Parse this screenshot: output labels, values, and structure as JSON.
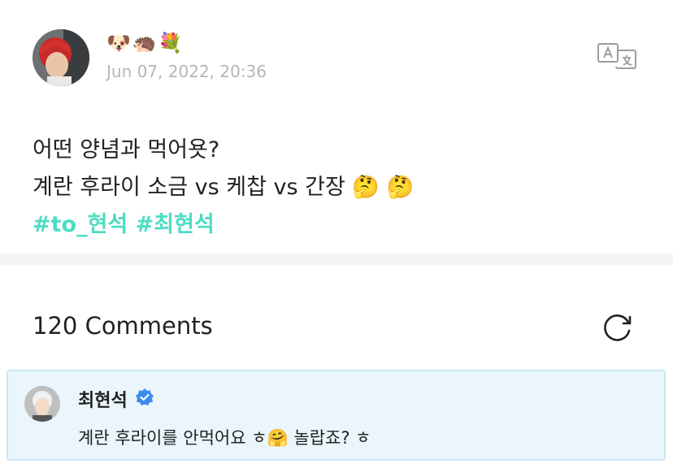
{
  "post": {
    "emojis": "🐶🦔💐",
    "timestamp": "Jun 07, 2022, 20:36",
    "line1": "어떤 양념과 먹어욧?",
    "line2": "계란 후라이 소금 vs 케찹 vs 간장 🤔 🤔",
    "hashtags": [
      "#to_현석",
      "#최현석"
    ]
  },
  "translate_icon": "translate-icon",
  "comments": {
    "header": "120 Comments",
    "refresh_icon": "refresh-icon"
  },
  "comment": {
    "author": "최현석",
    "text": "계란 후라이를 안먹어요 ㅎ🤗 놀랍죠? ㅎ"
  },
  "colors": {
    "hashtag": "#4ddcc4",
    "comment_bg": "#eaf6fc",
    "comment_border": "#c8e6f2",
    "verified": "#3d8bef"
  }
}
